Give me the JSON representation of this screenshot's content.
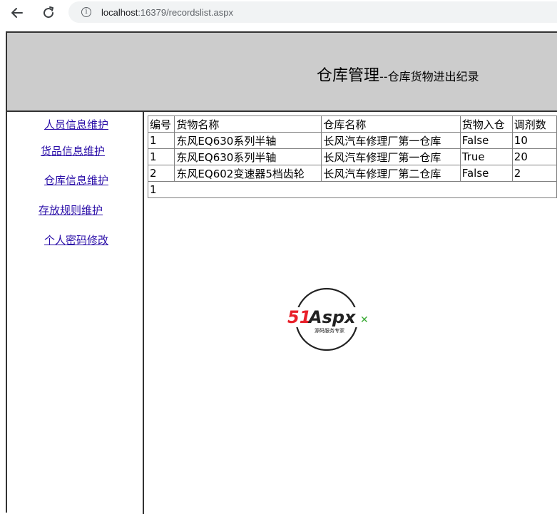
{
  "browser": {
    "url_host": "localhost",
    "url_rest": ":16379/recordslist.aspx"
  },
  "header": {
    "title": "仓库管理",
    "subtitle": "--仓库货物进出纪录"
  },
  "sidebar": {
    "items": [
      {
        "label": "人员信息维护"
      },
      {
        "label": "货品信息维护"
      },
      {
        "label": "仓库信息维护"
      },
      {
        "label": "存放规则维护"
      },
      {
        "label": "个人密码修改"
      }
    ]
  },
  "table": {
    "headers": [
      "编号",
      "货物名称",
      "仓库名称",
      "货物入仓",
      "调剂数"
    ],
    "rows": [
      [
        "1",
        "东风EQ630系列半轴",
        "长风汽车修理厂第一仓库",
        "False",
        "10"
      ],
      [
        "1",
        "东风EQ630系列半轴",
        "长风汽车修理厂第一仓库",
        "True",
        "20"
      ],
      [
        "2",
        "东风EQ602变速器5档齿轮",
        "长风汽车修理厂第二仓库",
        "False",
        "2"
      ]
    ],
    "pager": "1"
  },
  "logo": {
    "brand": "51Aspx",
    "tagline": "源码服务专家"
  }
}
